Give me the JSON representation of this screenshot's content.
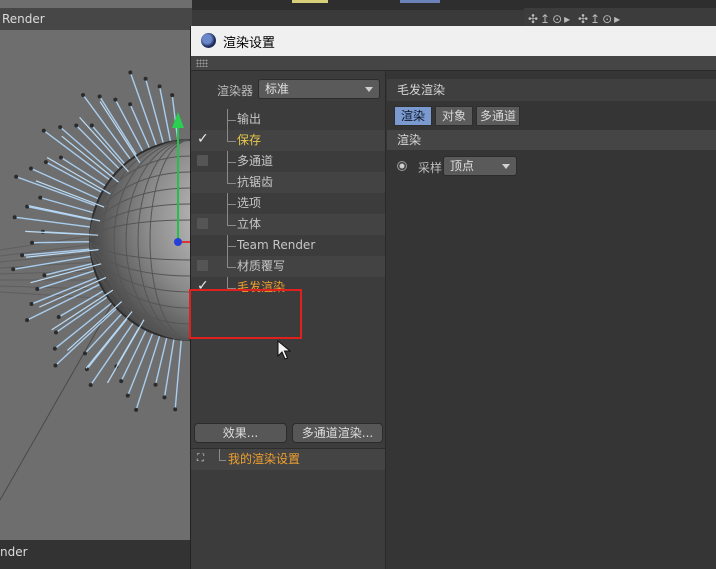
{
  "background": {
    "viewport_title": "Render",
    "bottom_title": "nder",
    "toolbar_icons": "✣↥⊙▸ ✣↥⊙▸"
  },
  "window": {
    "title": "渲染设置",
    "renderer_label": "渲染器",
    "renderer_value": "标准",
    "tree": [
      {
        "label": "输出",
        "checked": false,
        "has_box": false,
        "style": "normal"
      },
      {
        "label": "保存",
        "checked": true,
        "has_box": false,
        "style": "yellow"
      },
      {
        "label": "多通道",
        "checked": false,
        "has_box": true,
        "style": "normal"
      },
      {
        "label": "抗锯齿",
        "checked": false,
        "has_box": false,
        "style": "normal"
      },
      {
        "label": "选项",
        "checked": false,
        "has_box": false,
        "style": "normal"
      },
      {
        "label": "立体",
        "checked": false,
        "has_box": true,
        "style": "normal"
      },
      {
        "label": "Team Render",
        "checked": false,
        "has_box": false,
        "style": "normal"
      },
      {
        "label": "材质覆写",
        "checked": false,
        "has_box": true,
        "style": "normal"
      },
      {
        "label": "毛发渲染",
        "checked": true,
        "has_box": false,
        "style": "orange"
      }
    ],
    "effects_button": "效果...",
    "multipass_button": "多通道渲染...",
    "preset_label": "我的渲染设置",
    "panel_title": "毛发渲染",
    "tabs": [
      {
        "label": "渲染",
        "active": true
      },
      {
        "label": "对象",
        "active": false
      },
      {
        "label": "多通道",
        "active": false
      }
    ],
    "section_header": "渲染",
    "sample_label": "采样",
    "sample_value": "顶点"
  },
  "colors": {
    "accent_tab": "#7b9bd0",
    "highlight_box": "#e0201c",
    "active_item": "#f0a030",
    "checked_item": "#e6c84a"
  }
}
